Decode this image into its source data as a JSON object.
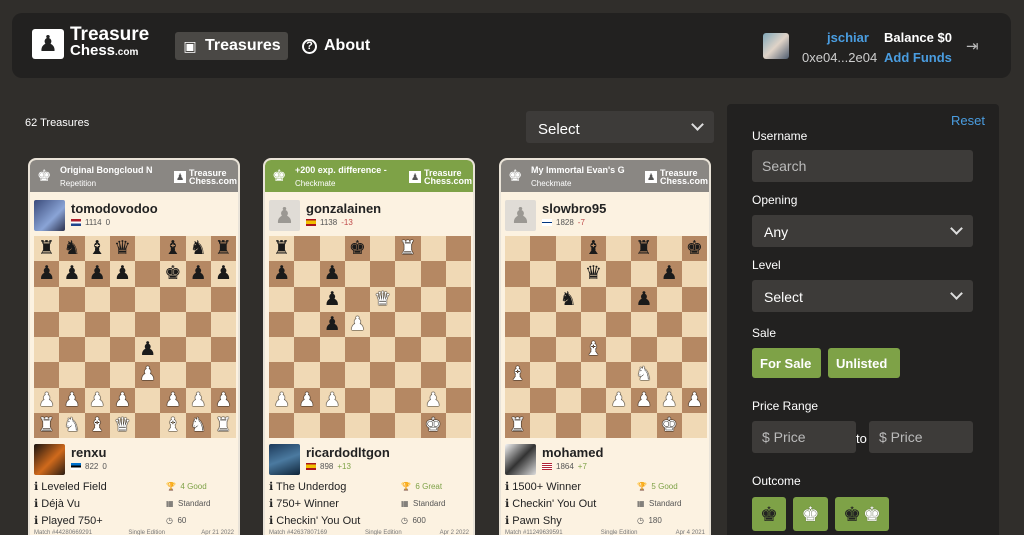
{
  "header": {
    "logo_line1": "Treasure",
    "logo_line2": "Chess",
    "logo_suffix": ".com",
    "nav": [
      {
        "label": "Treasures",
        "icon": "treasure-icon"
      },
      {
        "label": "About",
        "icon": "question-icon"
      }
    ],
    "username": "jschiar",
    "address": "0xe04...2e04",
    "balance": "Balance $0",
    "add_funds": "Add Funds"
  },
  "listing": {
    "count": "62  Treasures",
    "select_label": "Select"
  },
  "cards": [
    {
      "title": "Original Bongcloud N",
      "subtitle": "Repetition",
      "head_color": "gray",
      "brand1": "Treasure",
      "brand2": "Chess.com",
      "top_player": {
        "name": "tomodovodoo",
        "rating": "1114",
        "diff": "0",
        "diff_dir": "none",
        "flag": "nl"
      },
      "bottom_player": {
        "name": "renxu",
        "rating": "822",
        "diff": "0",
        "diff_dir": "none",
        "flag": "ee"
      },
      "achievements": [
        {
          "left": "Leveled Field",
          "right": "4 Good",
          "right_type": "good"
        },
        {
          "left": "Déjà Vu",
          "right": "Standard",
          "right_type": "plain"
        },
        {
          "left": "Played 750+",
          "right": "60",
          "right_type": "plain"
        }
      ],
      "footer_left": "Match #44280669291",
      "footer_mid": "Single Edition",
      "footer_right": "Apr 21 2022",
      "board": [
        "rnbq.bnr",
        "pppp.kpp",
        "........",
        "........",
        "....p...",
        "....P...",
        "PPPP.PPP",
        "RNBQ.BNR"
      ]
    },
    {
      "title": "+200 exp. difference -",
      "subtitle": "Checkmate",
      "head_color": "green",
      "brand1": "Treasure",
      "brand2": "Chess.com",
      "top_player": {
        "name": "gonzalainen",
        "rating": "1138",
        "diff": "-13",
        "diff_dir": "down",
        "flag": "es"
      },
      "bottom_player": {
        "name": "ricardodltgon",
        "rating": "898",
        "diff": "+13",
        "diff_dir": "up",
        "flag": "es"
      },
      "achievements": [
        {
          "left": "The Underdog",
          "right": "6 Great",
          "right_type": "good"
        },
        {
          "left": "750+ Winner",
          "right": "Standard",
          "right_type": "plain"
        },
        {
          "left": "Checkin' You Out",
          "right": "600",
          "right_type": "plain"
        }
      ],
      "footer_left": "Match #42637807169",
      "footer_mid": "Single Edition",
      "footer_right": "Apr 2 2022",
      "board": [
        "r..k.R..",
        "p.p.....",
        "..p.Q...",
        "..pP....",
        "........",
        "........",
        "PPP...P.",
        "......K."
      ]
    },
    {
      "title": "My Immortal Evan's G",
      "subtitle": "Checkmate",
      "head_color": "gray",
      "brand1": "Treasure",
      "brand2": "Chess.com",
      "top_player": {
        "name": "slowbro95",
        "rating": "1828",
        "diff": "-7",
        "diff_dir": "down",
        "flag": "fi"
      },
      "bottom_player": {
        "name": "mohamed",
        "rating": "1864",
        "diff": "+7",
        "diff_dir": "up",
        "flag": "us"
      },
      "achievements": [
        {
          "left": "1500+ Winner",
          "right": "5 Good",
          "right_type": "good"
        },
        {
          "left": "Checkin' You Out",
          "right": "Standard",
          "right_type": "plain"
        },
        {
          "left": "Pawn Shy",
          "right": "180",
          "right_type": "plain"
        }
      ],
      "footer_left": "Match #11249639591",
      "footer_mid": "Single Edition",
      "footer_right": "Apr 4 2021",
      "board": [
        "...b.r.k",
        "...q..p.",
        "..n..p..",
        "........",
        "...B....",
        "B....N..",
        "....PPPP",
        "R.....K."
      ]
    }
  ],
  "filters": {
    "reset": "Reset",
    "username_label": "Username",
    "username_placeholder": "Search",
    "opening_label": "Opening",
    "opening_value": "Any",
    "level_label": "Level",
    "level_value": "Select",
    "sale_label": "Sale",
    "sale_for_sale": "For Sale",
    "sale_unlisted": "Unlisted",
    "price_label": "Price Range",
    "price_min_placeholder": "$ Price",
    "price_to": "to",
    "price_max_placeholder": "$ Price",
    "outcome_label": "Outcome"
  },
  "colors": {
    "accent_green": "#7ea247",
    "link_blue": "#4a9de0",
    "light_square": "#f0d9b5",
    "dark_square": "#b58863"
  }
}
